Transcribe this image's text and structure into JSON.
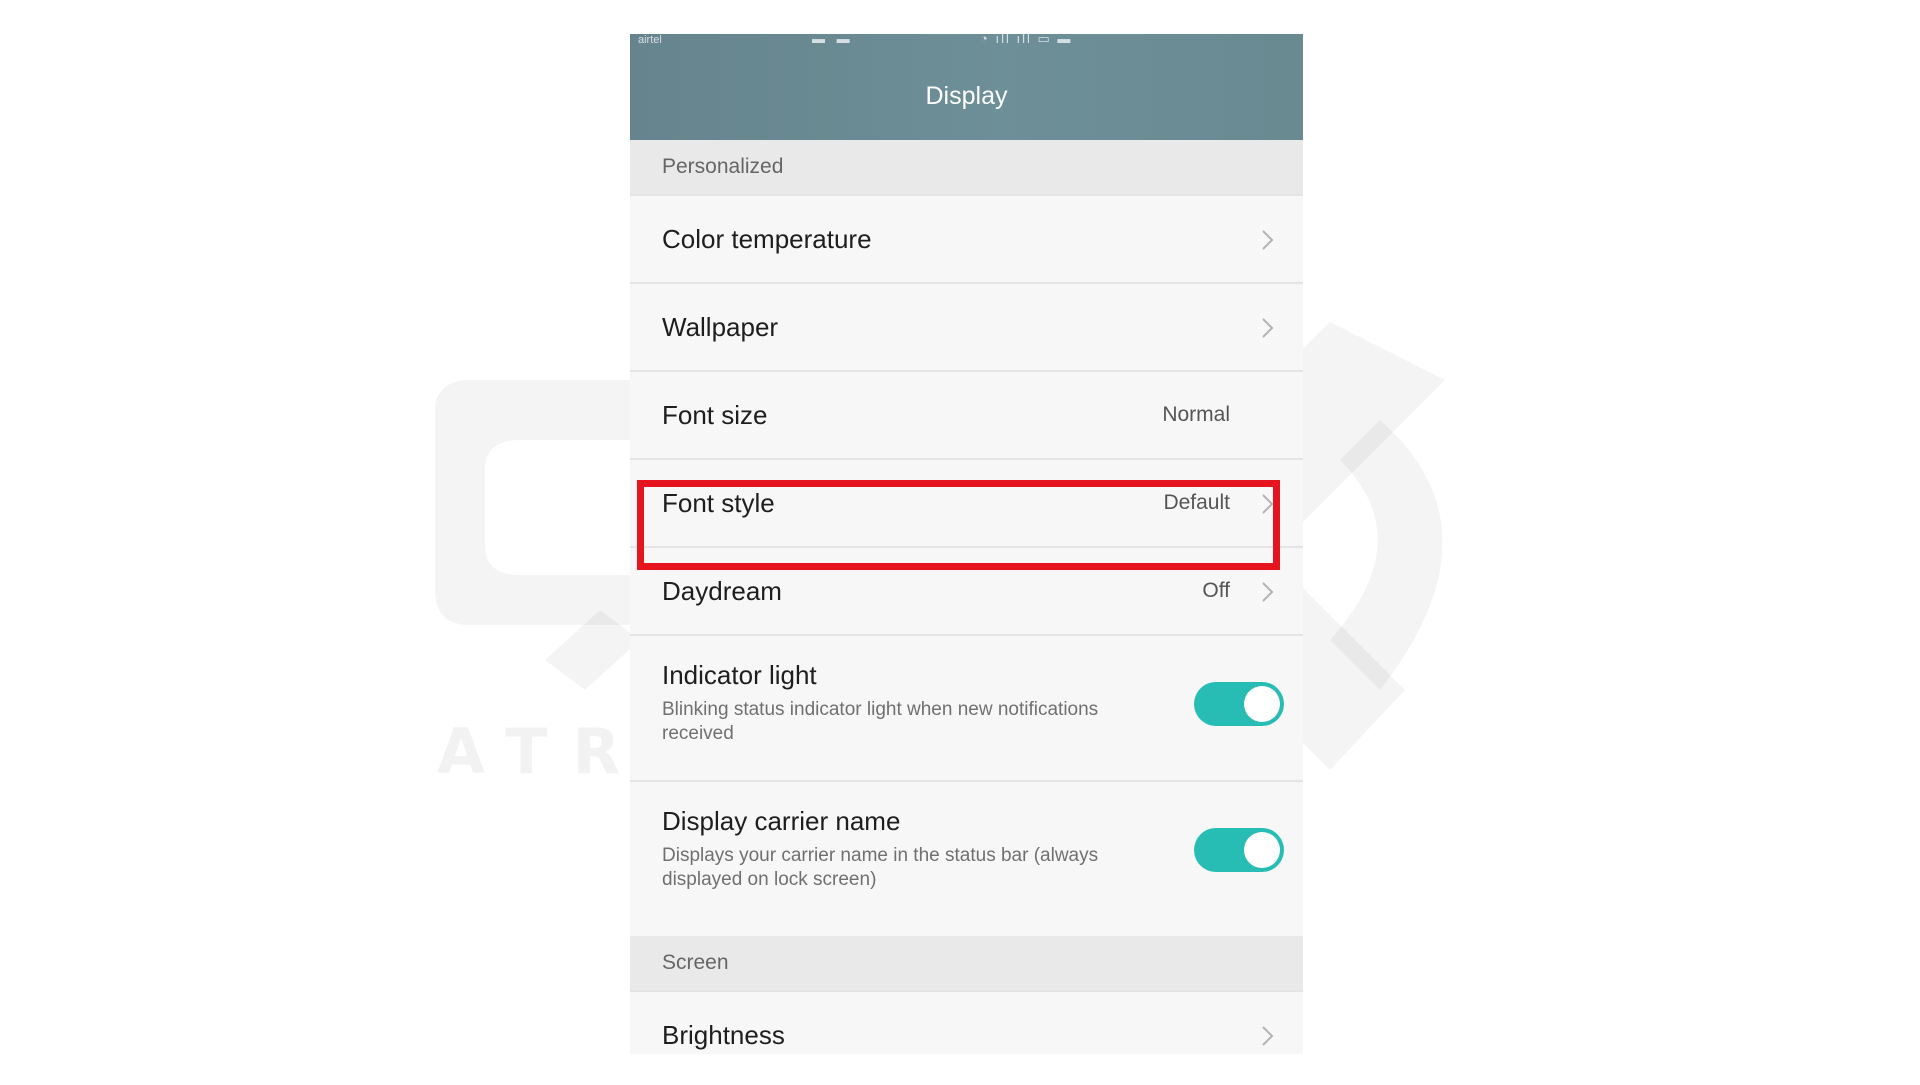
{
  "status_bar": {
    "carrier": "airtel"
  },
  "header": {
    "title": "Display"
  },
  "sections": {
    "personalized": "Personalized",
    "screen": "Screen"
  },
  "rows": {
    "color_temperature": {
      "label": "Color temperature"
    },
    "wallpaper": {
      "label": "Wallpaper"
    },
    "font_size": {
      "label": "Font size",
      "value": "Normal"
    },
    "font_style": {
      "label": "Font style",
      "value": "Default"
    },
    "daydream": {
      "label": "Daydream",
      "value": "Off"
    },
    "indicator_light": {
      "label": "Indicator light",
      "description": "Blinking status indicator light when new notifications received",
      "enabled": true
    },
    "display_carrier_name": {
      "label": "Display carrier name",
      "description": "Displays your carrier name in the status bar (always displayed on lock screen)",
      "enabled": true
    },
    "brightness": {
      "label": "Brightness"
    }
  },
  "watermark": {
    "text": "ATRO ACADEMY"
  },
  "colors": {
    "header": "#6a8a92",
    "toggle_on": "#27bdb5",
    "highlight": "#e5141e",
    "section_bg": "#e9e9e9",
    "row_bg": "#f7f7f7"
  }
}
